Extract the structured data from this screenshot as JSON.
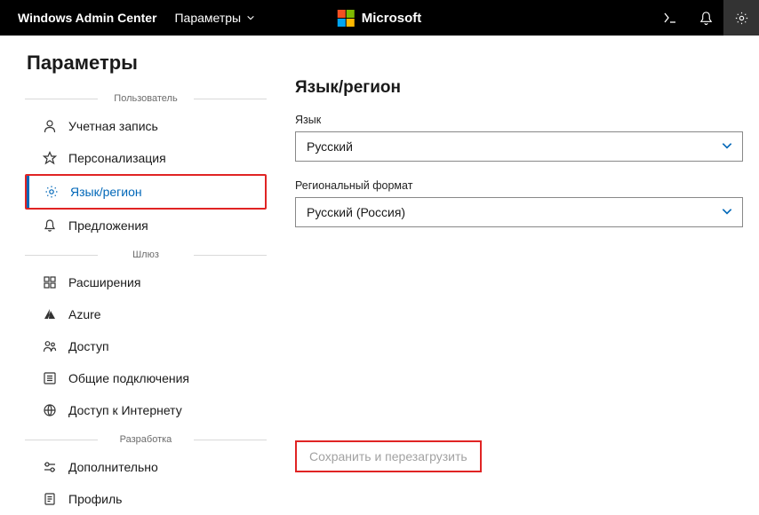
{
  "header": {
    "brand": "Windows Admin Center",
    "breadcrumb": "Параметры",
    "ms_text": "Microsoft"
  },
  "page": {
    "title": "Параметры"
  },
  "sections": {
    "user": "Пользователь",
    "gateway": "Шлюз",
    "dev": "Разработка"
  },
  "nav": {
    "account": "Учетная запись",
    "personalization": "Персонализация",
    "language": "Язык/регион",
    "suggestions": "Предложения",
    "extensions": "Расширения",
    "azure": "Azure",
    "access": "Доступ",
    "shared_conn": "Общие подключения",
    "internet": "Доступ к Интернету",
    "advanced": "Дополнительно",
    "profile": "Профиль"
  },
  "main": {
    "title": "Язык/регион",
    "lang_label": "Язык",
    "lang_value": "Русский",
    "region_label": "Региональный формат",
    "region_value": "Русский (Россия)",
    "save_label": "Сохранить и перезагрузить"
  }
}
